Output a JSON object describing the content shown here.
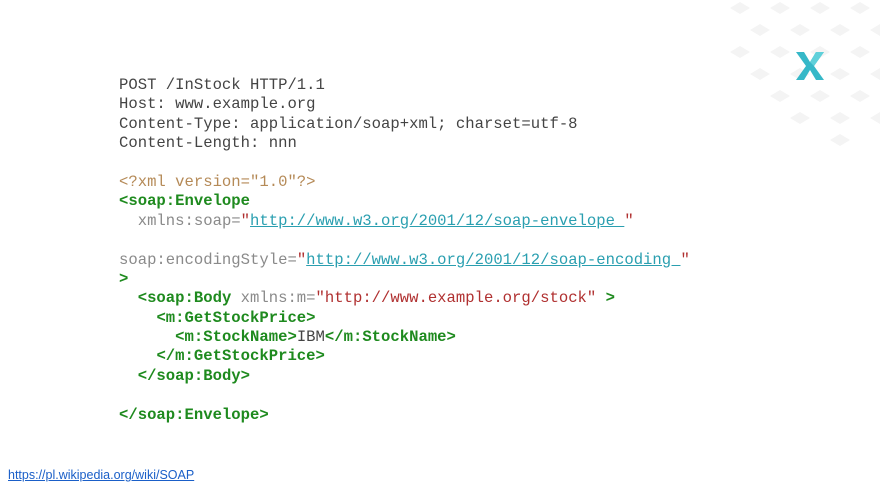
{
  "logo_icon": "x-brand-logo",
  "colors": {
    "tag": "#1e8a1e",
    "declaration": "#b58a57",
    "attribute": "#8a8a8a",
    "string": "#b03030",
    "url": "#2a9fb0",
    "plain": "#444444",
    "logo": "#36b8c8"
  },
  "http_headers": [
    "POST /InStock HTTP/1.1",
    "Host: www.example.org",
    "Content-Type: application/soap+xml; charset=utf-8",
    "Content-Length: nnn"
  ],
  "xml": {
    "declaration": "<?xml version=\"1.0\"?>",
    "envelope_open": "<soap:Envelope",
    "xmlns_attr": "xmlns:soap=",
    "xmlns_url": "http://www.w3.org/2001/12/soap-envelope ",
    "encoding_attr": "soap:encodingStyle=",
    "encoding_url": "http://www.w3.org/2001/12/soap-encoding ",
    "quote": "\"",
    "close_bracket": ">",
    "body_open": "<soap:Body",
    "body_attr": "xmlns:m=",
    "body_attr_value": "\"http://www.example.org/stock\"",
    "get_stock_open": "<m:GetStockPrice>",
    "stock_name_open": "<m:StockName>",
    "stock_name_value": "IBM",
    "stock_name_close": "</m:StockName>",
    "get_stock_close": "</m:GetStockPrice>",
    "body_close": "</soap:Body>",
    "envelope_close": "</soap:Envelope>"
  },
  "source_link": "https://pl.wikipedia.org/wiki/SOAP"
}
